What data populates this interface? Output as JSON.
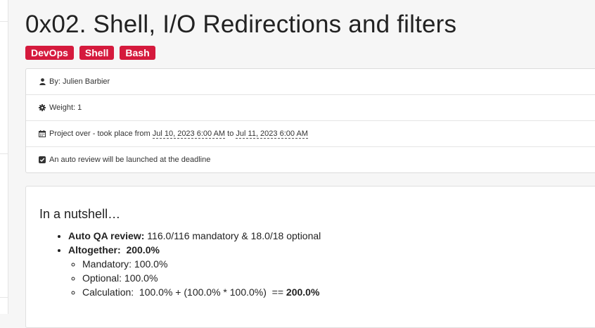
{
  "page": {
    "title": "0x02. Shell, I/O Redirections and filters"
  },
  "tags": [
    "DevOps",
    "Shell",
    "Bash"
  ],
  "info": {
    "author": "By: Julien Barbier",
    "weight": "Weight: 1",
    "project_prefix": "Project over - took place from",
    "start_date": "Jul 10, 2023 6:00 AM",
    "to_word": "to",
    "end_date": "Jul 11, 2023 6:00 AM",
    "auto_review": "An auto review will be launched at the deadline"
  },
  "nutshell": {
    "heading": "In a nutshell…",
    "auto_qa_label": "Auto QA review:",
    "auto_qa_value": "116.0/116 mandatory & 18.0/18 optional",
    "altogether_label": "Altogether:",
    "altogether_value": "200.0%",
    "mandatory": "Mandatory: 100.0%",
    "optional": "Optional: 100.0%",
    "calculation_text": "Calculation:  100.0% + (100.0% * 100.0%)  ==",
    "calculation_result": "200.0%"
  },
  "colors": {
    "tag_bg": "#d51a3d",
    "page_bg": "#f6f6f6"
  },
  "icons": [
    "user-icon",
    "cog-icon",
    "calendar-icon",
    "check-square-icon"
  ]
}
